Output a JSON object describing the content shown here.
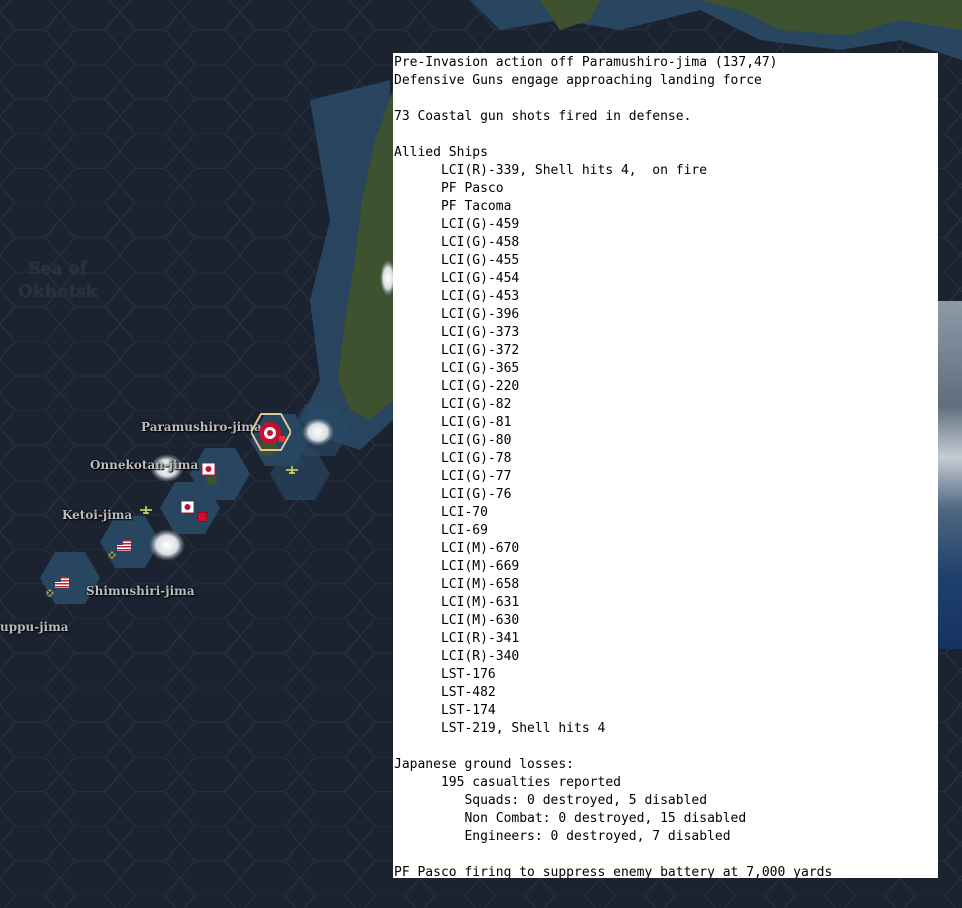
{
  "map": {
    "sea_name": "Sea of\nOkhotsk",
    "locations": {
      "paramushiro": "Paramushiro-jima",
      "onnekotan": "Onnekotan-jima",
      "ketoi": "Ketoi-jima",
      "shimushiri": "Shimushiri-jima",
      "uruppu": "uppu-jima"
    },
    "colors": {
      "sea_dark": "#1b2230",
      "coastal_water": "#2a4a66",
      "land": "#3e5230",
      "japan_flag": "#c8102e",
      "us_flag": "#3c3b6e"
    }
  },
  "report": {
    "lines": [
      "Pre-Invasion action off Paramushiro-jima (137,47)",
      "Defensive Guns engage approaching landing force",
      "",
      "73 Coastal gun shots fired in defense.",
      "",
      "Allied Ships",
      "      LCI(R)-339, Shell hits 4,  on fire",
      "      PF Pasco",
      "      PF Tacoma",
      "      LCI(G)-459",
      "      LCI(G)-458",
      "      LCI(G)-455",
      "      LCI(G)-454",
      "      LCI(G)-453",
      "      LCI(G)-396",
      "      LCI(G)-373",
      "      LCI(G)-372",
      "      LCI(G)-365",
      "      LCI(G)-220",
      "      LCI(G)-82",
      "      LCI(G)-81",
      "      LCI(G)-80",
      "      LCI(G)-78",
      "      LCI(G)-77",
      "      LCI(G)-76",
      "      LCI-70",
      "      LCI-69",
      "      LCI(M)-670",
      "      LCI(M)-669",
      "      LCI(M)-658",
      "      LCI(M)-631",
      "      LCI(M)-630",
      "      LCI(R)-341",
      "      LCI(R)-340",
      "      LST-176",
      "      LST-482",
      "      LST-174",
      "      LST-219, Shell hits 4",
      "",
      "Japanese ground losses:",
      "      195 casualties reported",
      "         Squads: 0 destroyed, 5 disabled",
      "         Non Combat: 0 destroyed, 15 disabled",
      "         Engineers: 0 destroyed, 7 disabled",
      "",
      "PF Pasco firing to suppress enemy battery at 7,000 yards"
    ]
  }
}
